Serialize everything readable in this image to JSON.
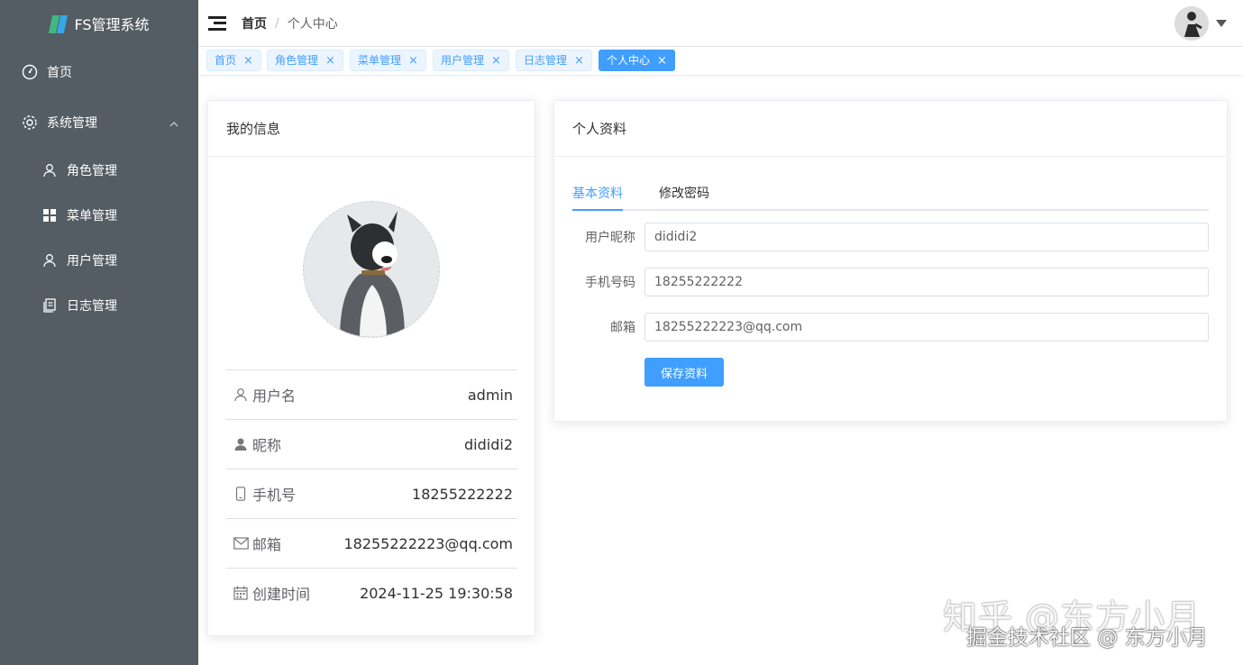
{
  "sidebar": {
    "brand": "FS管理系统",
    "home": "首页",
    "system": "系统管理",
    "items": [
      {
        "label": "角色管理",
        "icon": "user-icon"
      },
      {
        "label": "菜单管理",
        "icon": "grid-icon"
      },
      {
        "label": "用户管理",
        "icon": "user-icon"
      },
      {
        "label": "日志管理",
        "icon": "document-icon"
      }
    ]
  },
  "header": {
    "crumb_home": "首页",
    "crumb_sep": "/",
    "crumb_current": "个人中心"
  },
  "tags": [
    {
      "label": "首页"
    },
    {
      "label": "角色管理"
    },
    {
      "label": "菜单管理"
    },
    {
      "label": "用户管理"
    },
    {
      "label": "日志管理"
    },
    {
      "label": "个人中心",
      "active": true
    }
  ],
  "left_card": {
    "title": "我的信息",
    "rows": [
      {
        "label": "用户名",
        "value": "admin",
        "icon": "user-outline-icon"
      },
      {
        "label": "昵称",
        "value": "dididi2",
        "icon": "user-solid-icon"
      },
      {
        "label": "手机号",
        "value": "18255222222",
        "icon": "mobile-icon"
      },
      {
        "label": "邮箱",
        "value": "18255222223@qq.com",
        "icon": "mail-icon"
      },
      {
        "label": "创建时间",
        "value": "2024-11-25 19:30:58",
        "icon": "calendar-icon"
      }
    ]
  },
  "right_card": {
    "title": "个人资料",
    "tabs": [
      {
        "label": "基本资料",
        "active": true
      },
      {
        "label": "修改密码"
      }
    ],
    "fields": [
      {
        "label": "用户昵称",
        "value": "dididi2"
      },
      {
        "label": "手机号码",
        "value": "18255222222"
      },
      {
        "label": "邮箱",
        "value": "18255222223@qq.com"
      }
    ],
    "save_label": "保存资料"
  },
  "watermark": {
    "line1": "知乎 @东方小月",
    "line2": "掘金技术社区 @ 东方小月"
  },
  "colors": {
    "sidebar_bg": "#545c64",
    "accent": "#409eff"
  }
}
